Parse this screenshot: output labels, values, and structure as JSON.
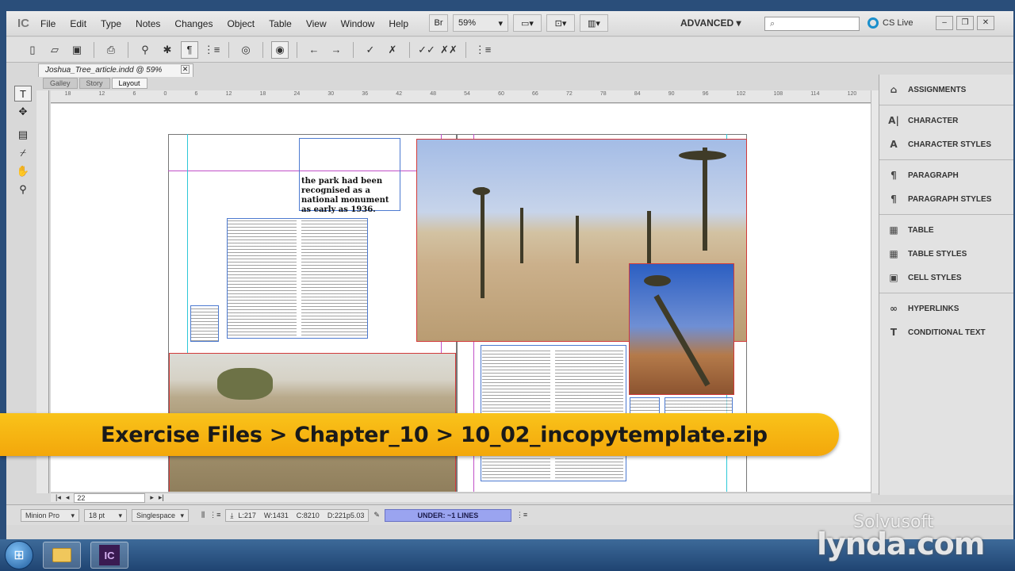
{
  "app": {
    "logo": "IC"
  },
  "menu": [
    "File",
    "Edit",
    "Type",
    "Notes",
    "Changes",
    "Object",
    "Table",
    "View",
    "Window",
    "Help"
  ],
  "menubar": {
    "bridge": "Br",
    "zoom": "59%",
    "workspace": "ADVANCED",
    "search_placeholder": "",
    "cs_live": "CS Live"
  },
  "document": {
    "tab_title": "Joshua_Tree_article.indd @ 59%",
    "views": [
      "Galley",
      "Story",
      "Layout"
    ],
    "active_view": "Layout"
  },
  "ruler": [
    "18",
    "12",
    "6",
    "0",
    "6",
    "12",
    "18",
    "24",
    "30",
    "36",
    "42",
    "48",
    "54",
    "60",
    "66",
    "72",
    "78",
    "84",
    "90",
    "96",
    "102",
    "108",
    "114",
    "120"
  ],
  "page": {
    "headline": "the park had been recognised as a national monument as early as 1936."
  },
  "panels": [
    [
      "ASSIGNMENTS"
    ],
    [
      "CHARACTER",
      "CHARACTER STYLES"
    ],
    [
      "PARAGRAPH",
      "PARAGRAPH STYLES"
    ],
    [
      "TABLE",
      "TABLE STYLES",
      "CELL STYLES"
    ],
    [
      "HYPERLINKS",
      "CONDITIONAL TEXT"
    ]
  ],
  "panel_icons": [
    "assignments-icon",
    "character-icon",
    "character-styles-icon",
    "paragraph-icon",
    "paragraph-styles-icon",
    "table-icon",
    "table-styles-icon",
    "cell-styles-icon",
    "hyperlinks-icon",
    "conditional-text-icon"
  ],
  "page_nav": {
    "page": "22"
  },
  "status": {
    "font": "Minion Pro",
    "size": "18 pt",
    "spacing": "Singlespace",
    "lines": "L:217",
    "words": "W:1431",
    "chars": "C:8210",
    "depth": "D:221p5.03",
    "overset": "UNDER: ~1 LINES"
  },
  "banner": "Exercise Files > Chapter_10 > 10_02_incopytemplate.zip",
  "watermark": {
    "site": "lynda.com",
    "brand": "Solvusoft"
  },
  "colors": {
    "accent_banner": "#f6b412",
    "overset": "#9aa4f0",
    "frame_red": "#d23a3a",
    "guide_magenta": "#c050c8",
    "guide_cyan": "#2cc8d8"
  }
}
